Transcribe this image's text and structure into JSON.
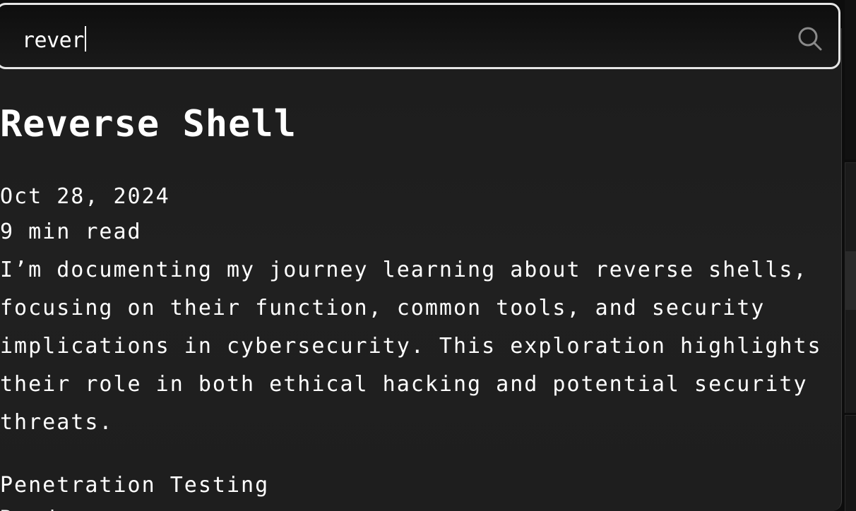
{
  "search": {
    "value": "rever"
  },
  "result": {
    "title": "Reverse Shell",
    "date": "Oct 28, 2024",
    "read_time": "9 min read",
    "excerpt": "I’m documenting my journey learning about reverse shells, focusing on their function, common tools, and security implications in cybersecurity. This exploration highlights their role in both ethical hacking and potential security threats.",
    "tag": "Penetration Testing",
    "link_label": "Read more →"
  },
  "icons": {
    "search": "search-icon"
  },
  "colors": {
    "border": "#e6e6e6",
    "background": "#1e1e1e",
    "text": "#ffffff"
  }
}
